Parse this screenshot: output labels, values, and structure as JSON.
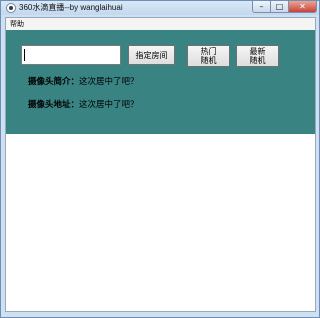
{
  "window": {
    "title": "360水滴直播--by wanglaihuai",
    "minimize_glyph": "–",
    "maximize_glyph": "□",
    "close_glyph": "✕"
  },
  "menu": {
    "items": [
      "帮助"
    ]
  },
  "controls": {
    "room_input_value": "",
    "room_button": "指定房间",
    "hot_random_button": [
      "热门",
      "随机"
    ],
    "new_random_button": [
      "最新",
      "随机"
    ]
  },
  "info": {
    "intro_label": "摄像头简介：",
    "intro_value": "这次居中了吧？",
    "address_label": "摄像头地址：",
    "address_value": "这次居中了吧？"
  },
  "colors": {
    "panel": "#3a8383",
    "window_frame": "#cfe0f2",
    "close_button": "#c8433a"
  }
}
